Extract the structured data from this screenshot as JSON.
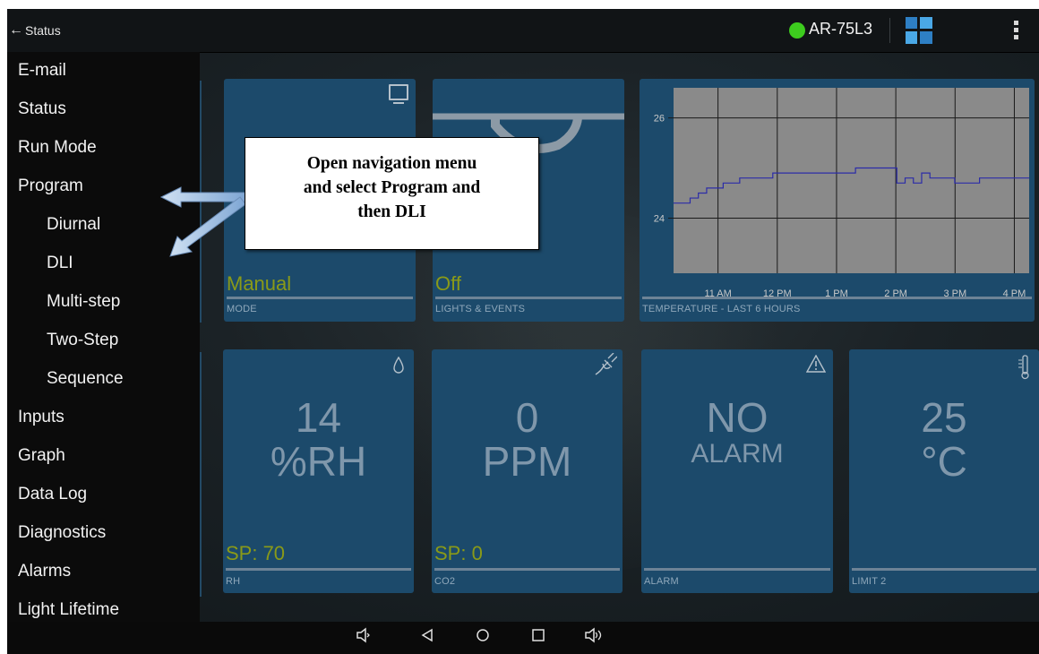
{
  "topbar": {
    "back_label": "Status",
    "device_id": "AR-75L3",
    "status_color": "#3dcc1e"
  },
  "sidebar": {
    "items": [
      {
        "label": "E-mail",
        "level": 0
      },
      {
        "label": "Status",
        "level": 0
      },
      {
        "label": "Run Mode",
        "level": 0
      },
      {
        "label": "Program",
        "level": 0
      },
      {
        "label": "Diurnal",
        "level": 1
      },
      {
        "label": "DLI",
        "level": 1
      },
      {
        "label": "Multi-step",
        "level": 1
      },
      {
        "label": "Two-Step",
        "level": 1
      },
      {
        "label": "Sequence",
        "level": 1
      },
      {
        "label": "Inputs",
        "level": 0
      },
      {
        "label": "Graph",
        "level": 0
      },
      {
        "label": "Data Log",
        "level": 0
      },
      {
        "label": "Diagnostics",
        "level": 0
      },
      {
        "label": "Alarms",
        "level": 0
      },
      {
        "label": "Light Lifetime",
        "level": 0
      }
    ]
  },
  "cards": {
    "mode": {
      "value": "Manual",
      "caption": "MODE",
      "icon": "monitor-icon"
    },
    "lights": {
      "value": "Off",
      "caption": "LIGHTS & EVENTS",
      "icon": "lamp-icon"
    },
    "rh": {
      "value": "14",
      "unit": "%RH",
      "setpoint": "SP: 70",
      "caption": "RH",
      "icon": "droplet-icon"
    },
    "co2": {
      "value": "0",
      "unit": "PPM",
      "setpoint": "SP: 0",
      "caption": "CO2",
      "icon": "plug-icon"
    },
    "alarm": {
      "value": "NO",
      "unit": "ALARM",
      "caption": "ALARM",
      "icon": "warning-icon"
    },
    "limit": {
      "value": "25",
      "unit": "°C",
      "caption": "LIMIT 2",
      "icon": "thermometer-icon"
    }
  },
  "chart_data": {
    "type": "line",
    "title": "TEMPERATURE - LAST 6 HOURS",
    "x_ticks": [
      "11 AM",
      "12 PM",
      "1 PM",
      "2 PM",
      "3 PM",
      "4 PM"
    ],
    "y_ticks": [
      24,
      26
    ],
    "ylim": [
      22.9,
      26.6
    ],
    "grid": true,
    "series": [
      {
        "values": [
          24.3,
          24.3,
          24.4,
          24.5,
          24.6,
          24.6,
          24.7,
          24.7,
          24.8,
          24.8,
          24.8,
          24.8,
          24.9,
          24.9,
          24.9,
          24.9,
          24.9,
          24.9,
          24.9,
          24.9,
          24.9,
          24.9,
          25.0,
          25.0,
          25.0,
          25.0,
          25.0,
          24.7,
          24.8,
          24.7,
          24.9,
          24.8,
          24.8,
          24.8,
          24.7,
          24.7,
          24.7,
          24.8,
          24.8,
          24.8,
          24.8,
          24.8,
          24.8,
          24.8
        ]
      }
    ],
    "line_color": "#2c2ca8"
  },
  "callout": {
    "lines": [
      "Open navigation menu",
      "and select Program and",
      "then DLI"
    ]
  },
  "navbar": {
    "keys": [
      "volume-down-icon",
      "back-icon",
      "home-icon",
      "recents-icon",
      "volume-up-icon"
    ]
  }
}
